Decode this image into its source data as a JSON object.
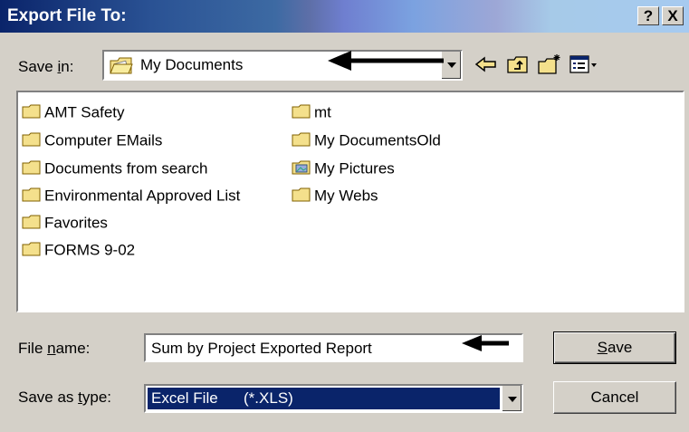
{
  "window": {
    "title": "Export File To:",
    "help_label": "?",
    "close_label": "X"
  },
  "save_in": {
    "label_pre": "Save ",
    "label_accel": "i",
    "label_post": "n:",
    "value": "My Documents"
  },
  "toolbar": {
    "icons": [
      "back-arrow-icon",
      "up-one-level-icon",
      "new-folder-icon",
      "view-menu-icon"
    ]
  },
  "files": {
    "column1": [
      "AMT Safety",
      "Computer EMails",
      "Documents from search",
      "Environmental Approved List",
      "Favorites",
      "FORMS 9-02"
    ],
    "column2": [
      "mt",
      "My DocumentsOld",
      "My Pictures",
      "My Webs"
    ]
  },
  "file_name": {
    "label_pre": "File ",
    "label_accel": "n",
    "label_post": "ame:",
    "value": "Sum by Project Exported Report"
  },
  "file_type": {
    "label_pre": "Save as ",
    "label_accel": "t",
    "label_post": "ype:",
    "value": "Excel File      (*.XLS)"
  },
  "buttons": {
    "save_accel": "S",
    "save_rest": "ave",
    "cancel": "Cancel"
  },
  "colors": {
    "face": "#d4d0c8",
    "selection": "#0a246a",
    "folder": "#f4e08c"
  }
}
